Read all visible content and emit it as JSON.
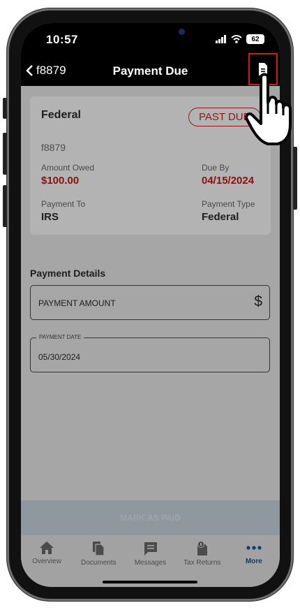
{
  "status_bar": {
    "time": "10:57",
    "battery": "62"
  },
  "nav": {
    "back_label": "f8879",
    "title": "Payment Due",
    "document_icon": "document-icon"
  },
  "card": {
    "title": "Federal",
    "badge": "PAST DUE",
    "code": "f8879",
    "amount_owed_label": "Amount Owed",
    "amount_owed": "$100.00",
    "due_by_label": "Due By",
    "due_by": "04/15/2024",
    "payment_to_label": "Payment To",
    "payment_to": "IRS",
    "payment_type_label": "Payment Type",
    "payment_type": "Federal"
  },
  "details": {
    "section_title": "Payment Details",
    "amount_placeholder": "PAYMENT AMOUNT",
    "date_label": "PAYMENT DATE",
    "date_value": "05/30/2024"
  },
  "action": {
    "mark_paid": "MARK AS PAID"
  },
  "tabs": [
    {
      "label": "Overview",
      "icon": "home-icon"
    },
    {
      "label": "Documents",
      "icon": "documents-icon"
    },
    {
      "label": "Messages",
      "icon": "messages-icon"
    },
    {
      "label": "Tax Returns",
      "icon": "tax-returns-icon"
    },
    {
      "label": "More",
      "icon": "more-icon",
      "active": true
    }
  ],
  "colors": {
    "accent_red": "#8a1010",
    "active_tab": "#0b3c73",
    "highlight_border": "#d01c1c"
  }
}
